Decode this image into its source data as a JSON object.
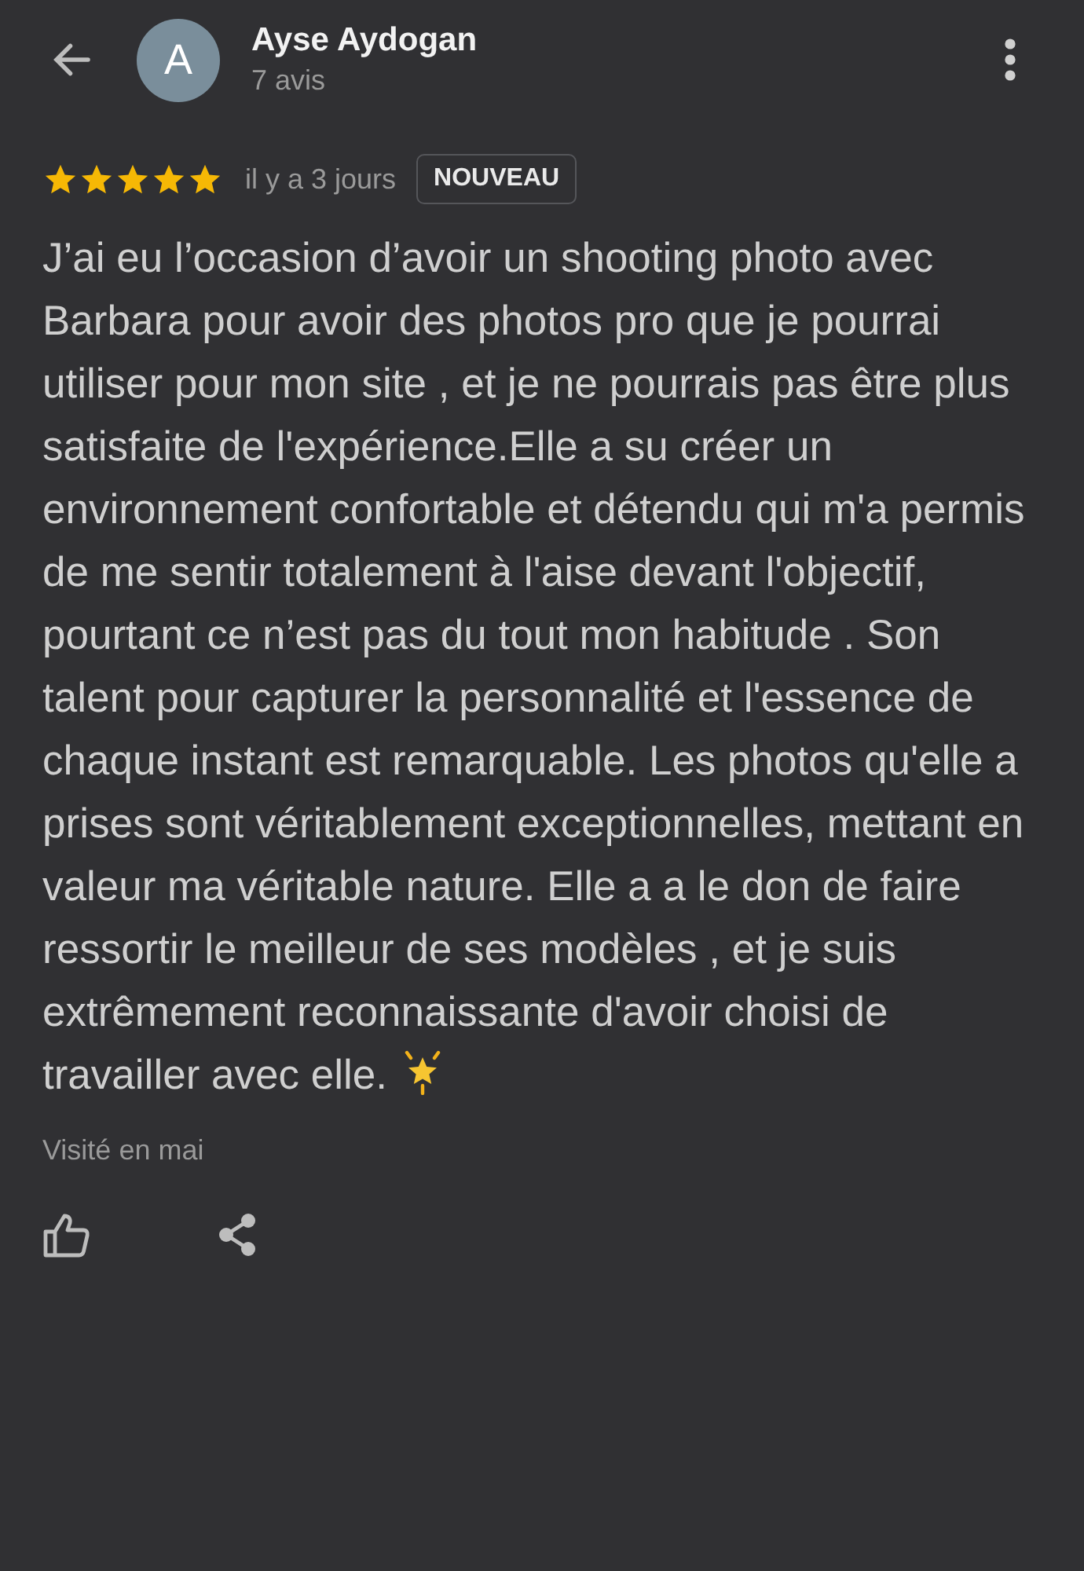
{
  "header": {
    "avatar_letter": "A",
    "name": "Ayse Aydogan",
    "subtitle": "7 avis"
  },
  "review": {
    "stars": 5,
    "time": "il y a 3 jours",
    "badge": "NOUVEAU",
    "text": "J’ai eu l’occasion d’avoir un shooting photo avec Barbara pour avoir des photos pro que je pourrai utiliser pour mon site , et je ne pourrais pas être plus satisfaite de l'expérience.Elle a su créer un environnement confortable et détendu qui m'a permis de me sentir totalement à l'aise devant l'objectif, pourtant ce n’est pas du tout mon habitude . Son talent pour capturer la personnalité et l'essence de chaque instant est remarquable. Les photos qu'elle a prises sont véritablement exceptionnelles, mettant en valeur ma véritable nature. Elle a a le don de faire ressortir le meilleur de ses modèles , et je suis extrêmement reconnaissante d'avoir choisi de travailler avec elle.",
    "visited": "Visité en mai"
  }
}
